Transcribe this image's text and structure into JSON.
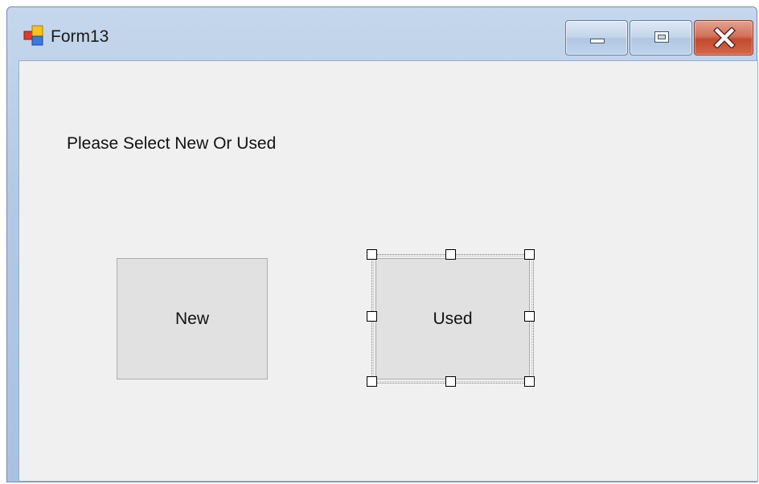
{
  "window": {
    "title": "Form13",
    "icon": "form-app-icon",
    "controls": {
      "minimize": "minimize-icon",
      "maximize": "maximize-icon",
      "close": "close-icon"
    }
  },
  "form": {
    "prompt_label": "Please Select New Or Used",
    "buttons": {
      "new_label": "New",
      "used_label": "Used"
    },
    "selected_control": "Used"
  },
  "colors": {
    "client_background": "#f0f0f0",
    "button_face": "#e1e1e1",
    "close_button": "#c44a2e",
    "title_bar": "#b3c9e4"
  }
}
